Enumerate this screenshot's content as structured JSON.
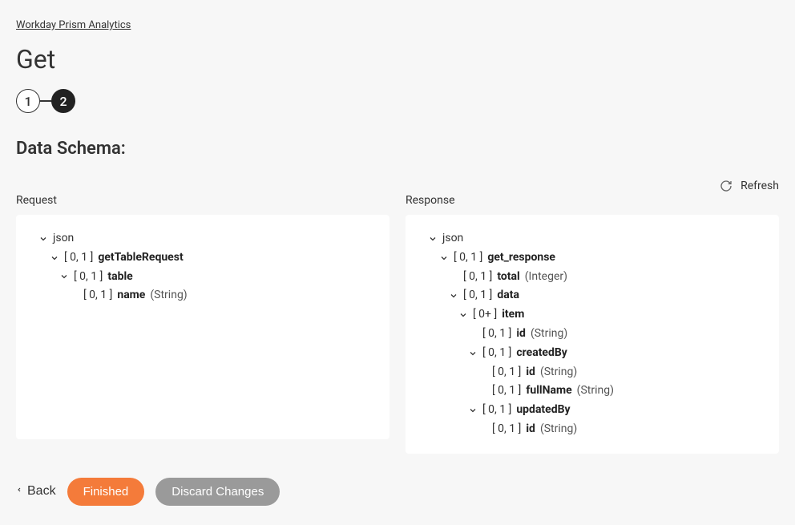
{
  "breadcrumb": "Workday Prism Analytics",
  "page_title": "Get",
  "stepper": {
    "step1": "1",
    "step2": "2"
  },
  "section_title": "Data Schema:",
  "refresh_label": "Refresh",
  "columns": {
    "request_heading": "Request",
    "response_heading": "Response"
  },
  "tree_common": {
    "root": "json"
  },
  "request_tree": {
    "n0": {
      "card": "[ 0, 1 ]",
      "name": "getTableRequest"
    },
    "n1": {
      "card": "[ 0, 1 ]",
      "name": "table"
    },
    "n2": {
      "card": "[ 0, 1 ]",
      "name": "name",
      "type": "(String)"
    }
  },
  "response_tree": {
    "n0": {
      "card": "[ 0, 1 ]",
      "name": "get_response"
    },
    "n1": {
      "card": "[ 0, 1 ]",
      "name": "total",
      "type": "(Integer)"
    },
    "n2": {
      "card": "[ 0, 1 ]",
      "name": "data"
    },
    "n3": {
      "card": "[ 0+ ]",
      "name": "item"
    },
    "n4": {
      "card": "[ 0, 1 ]",
      "name": "id",
      "type": "(String)"
    },
    "n5": {
      "card": "[ 0, 1 ]",
      "name": "createdBy"
    },
    "n6": {
      "card": "[ 0, 1 ]",
      "name": "id",
      "type": "(String)"
    },
    "n7": {
      "card": "[ 0, 1 ]",
      "name": "fullName",
      "type": "(String)"
    },
    "n8": {
      "card": "[ 0, 1 ]",
      "name": "updatedBy"
    },
    "n9": {
      "card": "[ 0, 1 ]",
      "name": "id",
      "type": "(String)"
    }
  },
  "footer": {
    "back": "Back",
    "finished": "Finished",
    "discard": "Discard Changes"
  }
}
